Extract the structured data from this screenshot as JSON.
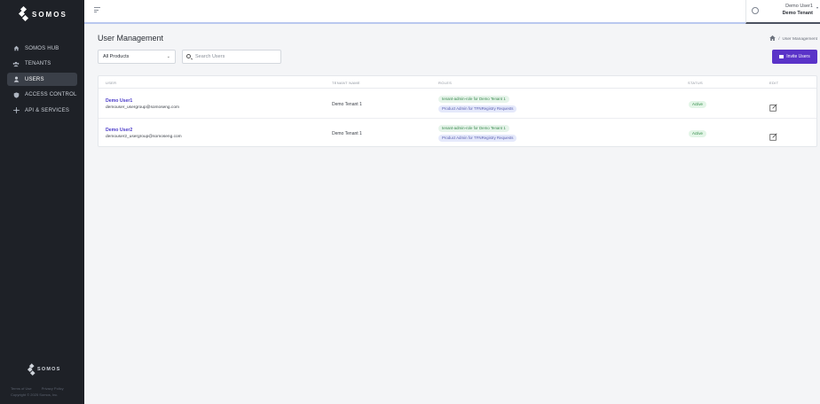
{
  "brand": {
    "name": "SOMOS"
  },
  "sidebar": {
    "items": [
      {
        "label": "SOMOS HUB",
        "icon": "home-icon",
        "active": false
      },
      {
        "label": "TENANTS",
        "icon": "users-group-icon",
        "active": false
      },
      {
        "label": "USERS",
        "icon": "user-icon",
        "active": true
      },
      {
        "label": "ACCESS CONTROL",
        "icon": "shield-icon",
        "active": false
      },
      {
        "label": "API & SERVICES",
        "icon": "api-icon",
        "active": false
      }
    ],
    "footer": {
      "terms": "Terms of Use",
      "privacy": "Privacy Policy",
      "copyright": "Copyright © 2025 Somos, Inc."
    }
  },
  "topbar": {
    "user_name": "Demo User1",
    "tenant_name": "Demo Tenant"
  },
  "page": {
    "title": "User Management",
    "breadcrumb_current": "User Management",
    "product_select": "All Products",
    "search_placeholder": "Search Users",
    "invite_label": "Invite Users"
  },
  "table": {
    "headers": {
      "user": "USER",
      "tenant": "TENANT NAME",
      "roles": "ROLES",
      "status": "STATUS",
      "edit": "EDIT"
    },
    "rows": [
      {
        "name": "Demo User1",
        "email": "demouser_usergroup@somoseng.com",
        "tenant": "Demo Tenant 1",
        "roles": [
          "tenant-admin-role for Demo Tenant 1",
          "Product Admin for TFNRegistry Requests"
        ],
        "status": "Active"
      },
      {
        "name": "Demo User2",
        "email": "demouser2_usergroup@somoseng.com",
        "tenant": "Demo Tenant 1",
        "roles": [
          "tenant-admin-role for Demo Tenant 1",
          "Product Admin for TFNRegistry Requests"
        ],
        "status": "Active"
      }
    ]
  },
  "colors": {
    "sidebar_bg": "#1e2127",
    "accent": "#5a33c8",
    "link": "#4b3bc9",
    "status_active": "#2f8a46"
  }
}
